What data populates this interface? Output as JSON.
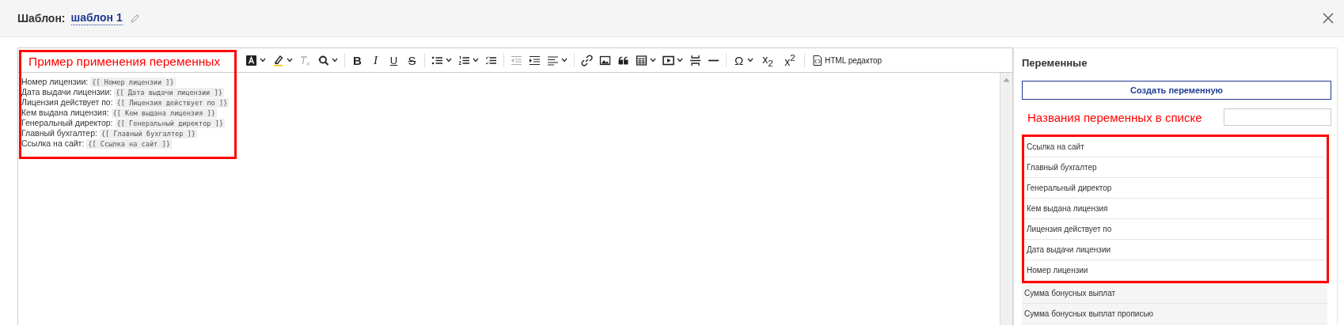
{
  "header": {
    "label": "Шаблон:",
    "template_name": "шаблон 1"
  },
  "editor": {
    "annotation": "Пример применения переменных",
    "toolbar": [
      {
        "kind": "font-color",
        "dropdown": true,
        "disabled": false
      },
      {
        "kind": "highlight",
        "dropdown": true,
        "disabled": false
      },
      {
        "kind": "clear-format",
        "dropdown": false,
        "disabled": true
      },
      {
        "kind": "find",
        "dropdown": true,
        "disabled": false
      },
      {
        "kind": "separator"
      },
      {
        "kind": "bold",
        "glyph": "B",
        "dropdown": false,
        "disabled": false
      },
      {
        "kind": "italic",
        "glyph": "I",
        "dropdown": false,
        "disabled": false
      },
      {
        "kind": "underline",
        "glyph": "U",
        "dropdown": false,
        "disabled": false
      },
      {
        "kind": "strike",
        "glyph": "S",
        "dropdown": false,
        "disabled": false
      },
      {
        "kind": "separator"
      },
      {
        "kind": "bullets",
        "dropdown": true,
        "disabled": false
      },
      {
        "kind": "numbers",
        "dropdown": true,
        "disabled": false
      },
      {
        "kind": "checklist",
        "disabled": false
      },
      {
        "kind": "separator"
      },
      {
        "kind": "outdent",
        "dropdown": false,
        "disabled": true
      },
      {
        "kind": "indent",
        "dropdown": false,
        "disabled": false
      },
      {
        "kind": "align",
        "dropdown": true,
        "disabled": false
      },
      {
        "kind": "separator"
      },
      {
        "kind": "link",
        "dropdown": false,
        "disabled": false
      },
      {
        "kind": "image",
        "dropdown": false,
        "disabled": false
      },
      {
        "kind": "quote",
        "dropdown": false,
        "disabled": false
      },
      {
        "kind": "table",
        "dropdown": true,
        "disabled": false
      },
      {
        "kind": "media",
        "dropdown": true,
        "disabled": false
      },
      {
        "kind": "page-break",
        "dropdown": false,
        "disabled": false
      },
      {
        "kind": "hr",
        "dropdown": false,
        "disabled": false
      },
      {
        "kind": "separator"
      },
      {
        "kind": "symbol",
        "glyph": "Ω",
        "dropdown": true,
        "disabled": false
      },
      {
        "kind": "subscript",
        "glyph": "x$_{2}$",
        "dropdown": false,
        "disabled": false
      },
      {
        "kind": "superscript",
        "glyph": "x$^{2}$",
        "dropdown": false,
        "disabled": false
      },
      {
        "kind": "separator"
      },
      {
        "kind": "html",
        "label": "HTML редактор",
        "dropdown": false,
        "disabled": false
      }
    ],
    "lines": [
      {
        "label": "Номер лицензии:",
        "code": "{[ Номер лицензии ]}"
      },
      {
        "label": "Дата выдачи лицензии:",
        "code": "{[ Дата выдачи лицензии ]}"
      },
      {
        "label": "Лицензия действует по:",
        "code": "{[ Лицензия действует по ]}"
      },
      {
        "label": "Кем выдана лицензия:",
        "code": "{[ Кем выдана лицензия ]}"
      },
      {
        "label": "Генеральный директор:",
        "code": "{[ Генеральный директор ]}"
      },
      {
        "label": "Главный бухгалтер:",
        "code": "{[ Главный бухгалтер ]}"
      },
      {
        "label": "Ссылка на сайт:",
        "code": "{[ Ссылка на сайт ]}"
      }
    ]
  },
  "variables": {
    "title": "Переменные",
    "create_button": "Создать переменную",
    "annotation": "Названия переменных в списке",
    "items": [
      {
        "name": "Ссылка на сайт",
        "highlighted": true
      },
      {
        "name": "Главный бухгалтер",
        "highlighted": true
      },
      {
        "name": "Генеральный директор",
        "highlighted": true
      },
      {
        "name": "Кем выдана лицензия",
        "highlighted": true
      },
      {
        "name": "Лицензия действует по",
        "highlighted": true
      },
      {
        "name": "Дата выдачи лицензии",
        "highlighted": true
      },
      {
        "name": "Номер лицензии",
        "highlighted": true
      },
      {
        "name": "Сумма бонусных выплат",
        "highlighted": false
      },
      {
        "name": "Сумма бонусных выплат прописью",
        "highlighted": false
      }
    ]
  }
}
